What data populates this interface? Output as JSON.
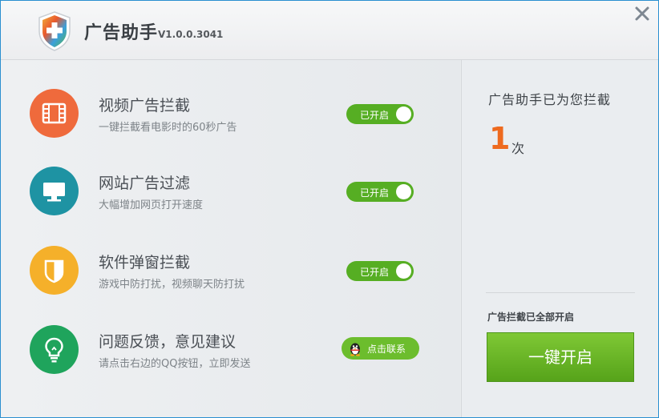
{
  "app": {
    "title": "广告助手",
    "version": "V1.0.0.3041"
  },
  "features": [
    {
      "title": "视频广告拦截",
      "desc": "一键拦截看电影时的60秒广告",
      "icon": "film-icon",
      "color": "#ef6a3c",
      "toggle_label": "已开启"
    },
    {
      "title": "网站广告过滤",
      "desc": "大幅增加网页打开速度",
      "icon": "monitor-icon",
      "color": "#1e93a3",
      "toggle_label": "已开启"
    },
    {
      "title": "软件弹窗拦截",
      "desc": "游戏中防打扰，视频聊天防打扰",
      "icon": "shield-icon",
      "color": "#f5b02a",
      "toggle_label": "已开启"
    },
    {
      "title": "问题反馈，意见建议",
      "desc": "请点击右边的QQ按钮，立即发送",
      "icon": "lightbulb-icon",
      "color": "#1fa45c",
      "button_label": "点击联系"
    }
  ],
  "stats": {
    "title": "广告助手已为您拦截",
    "count": "1",
    "unit": "次"
  },
  "status": "广告拦截已全部开启",
  "primary_button": "一键开启",
  "colors": {
    "toggle_on": "#56ae23",
    "count": "#ee6a1f",
    "primary": "#66b226"
  }
}
